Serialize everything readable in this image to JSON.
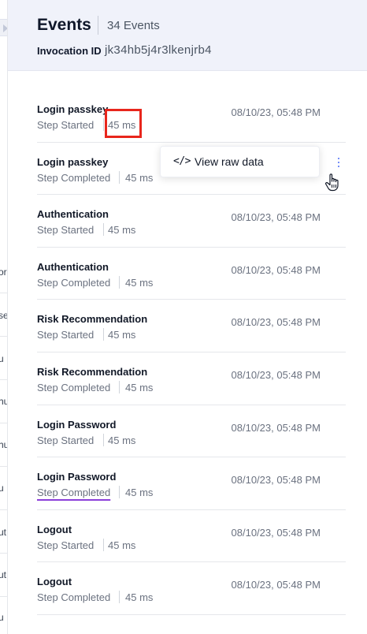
{
  "header": {
    "title": "Events",
    "event_count": "34 Events",
    "invocation_label": "Invocation ID",
    "invocation_id": "jk34hb5j4r3lkenjrb4"
  },
  "left_fragments": [
    "or",
    "se",
    "u",
    "hu",
    "hu",
    "u",
    "ut",
    "ut",
    "u"
  ],
  "events": [
    {
      "name": "Login passkey",
      "status": "Step Started",
      "duration": "45 ms",
      "time": "08/10/23, 05:48 PM"
    },
    {
      "name": "Login passkey",
      "status": "Step Completed",
      "duration": "45 ms",
      "time": ""
    },
    {
      "name": "Authentication",
      "status": "Step Started",
      "duration": "45 ms",
      "time": "08/10/23, 05:48 PM"
    },
    {
      "name": "Authentication",
      "status": "Step Completed",
      "duration": "45 ms",
      "time": "08/10/23, 05:48 PM"
    },
    {
      "name": "Risk Recommendation",
      "status": "Step Started",
      "duration": "45 ms",
      "time": "08/10/23, 05:48 PM"
    },
    {
      "name": "Risk Recommendation",
      "status": "Step Completed",
      "duration": "45 ms",
      "time": "08/10/23, 05:48 PM"
    },
    {
      "name": "Login Password",
      "status": "Step Started",
      "duration": "45 ms",
      "time": "08/10/23, 05:48 PM"
    },
    {
      "name": "Login Password",
      "status": "Step Completed",
      "duration": "45 ms",
      "time": "08/10/23, 05:48 PM"
    },
    {
      "name": "Logout",
      "status": "Step Started",
      "duration": "45 ms",
      "time": "08/10/23, 05:48 PM"
    },
    {
      "name": "Logout",
      "status": "Step Completed",
      "duration": "45 ms",
      "time": "08/10/23, 05:48 PM"
    }
  ],
  "context_menu": {
    "icon": "code-icon",
    "icon_glyph": "</>",
    "label": "View raw data"
  },
  "colors": {
    "header_bg": "#f0f2fa",
    "highlight": "#e8261c",
    "underline": "#8b3fd9",
    "kebab": "#4a6cf7"
  }
}
